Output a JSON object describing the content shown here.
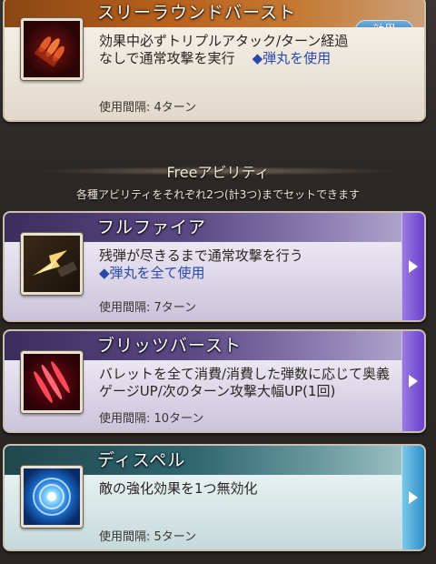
{
  "cards": [
    {
      "title": "スリーラウンドバースト",
      "badge": "効果",
      "desc_line1": "効果中必ずトリプルアタック/ターン経過",
      "desc_line2": "なしで通常攻撃を実行",
      "note": "◆弾丸を使用",
      "interval": "使用間隔: 4ターン",
      "icon": "triple-bullet-icon"
    },
    {
      "title": "フルファイア",
      "desc_line1": "残弾が尽きるまで通常攻撃を行う",
      "note": "◆弾丸を全て使用",
      "interval": "使用間隔: 7ターン",
      "icon": "muzzle-flash-icon"
    },
    {
      "title": "ブリッツバースト",
      "desc_line1": "バレットを全て消費/消費した弾数に応じて奥義",
      "desc_line2": "ゲージUP/次のターン攻撃大幅UP(1回)",
      "interval": "使用間隔: 10ターン",
      "icon": "red-slash-icon"
    },
    {
      "title": "ディスペル",
      "desc_line1": "敵の強化効果を1つ無効化",
      "interval": "使用間隔: 5ターン",
      "icon": "blue-vortex-icon"
    }
  ],
  "section": {
    "title": "Freeアビリティ",
    "subtitle": "各種アビリティをそれぞれ2つ(計3つ)までセットできます"
  },
  "colors": {
    "orange_header": "#b9621e",
    "purple_header": "#5c4a86",
    "teal_header": "#2f6670",
    "note_blue": "#2a49a8"
  }
}
